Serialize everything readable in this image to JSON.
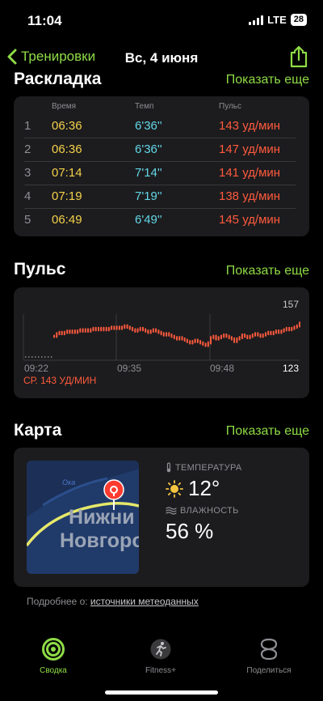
{
  "status": {
    "time": "11:04",
    "network": "LTE",
    "battery": "28"
  },
  "nav": {
    "back_label": "Тренировки",
    "title": "Вс, 4 июня"
  },
  "splits": {
    "title": "Раскладка",
    "show_more": "Показать еще",
    "headers": {
      "time": "Время",
      "pace": "Темп",
      "hr": "Пульс"
    },
    "rows": [
      {
        "n": "1",
        "time": "06:36",
        "pace": "6'36''",
        "hr": "143 уд/мин"
      },
      {
        "n": "2",
        "time": "06:36",
        "pace": "6'36''",
        "hr": "147 уд/мин"
      },
      {
        "n": "3",
        "time": "07:14",
        "pace": "7'14''",
        "hr": "141 уд/мин"
      },
      {
        "n": "4",
        "time": "07:19",
        "pace": "7'19''",
        "hr": "138 уд/мин"
      },
      {
        "n": "5",
        "time": "06:49",
        "pace": "6'49''",
        "hr": "145 уд/мин"
      }
    ]
  },
  "heart_rate": {
    "title": "Пульс",
    "show_more": "Показать еще",
    "max_label": "157",
    "min_label": "123",
    "avg_label": "СР. 143 УД/МИН",
    "time_ticks": [
      "09:22",
      "09:35",
      "09:48"
    ]
  },
  "chart_data": {
    "type": "bar",
    "title": "",
    "ylim": [
      123,
      157
    ],
    "x_ticks": [
      "09:22",
      "09:35",
      "09:48"
    ],
    "color": "#ff5a3d",
    "values": [
      140,
      142,
      143,
      142,
      143,
      144,
      143,
      144,
      143,
      144,
      145,
      144,
      145,
      144,
      145,
      146,
      145,
      146,
      145,
      146,
      145,
      146,
      147,
      146,
      147,
      146,
      147,
      148,
      147,
      146,
      145,
      144,
      145,
      146,
      145,
      144,
      143,
      144,
      145,
      144,
      143,
      142,
      141,
      142,
      141,
      140,
      139,
      138,
      139,
      138,
      137,
      136,
      135,
      136,
      137,
      136,
      135,
      134,
      133,
      135,
      139,
      140,
      138,
      139,
      140,
      141,
      140,
      139,
      138,
      136,
      138,
      139,
      141,
      140,
      139,
      140,
      141,
      142,
      141,
      140,
      141,
      142,
      143,
      142,
      143,
      144,
      143,
      144,
      145,
      146,
      145,
      146,
      147,
      148,
      150
    ]
  },
  "map": {
    "title": "Карта",
    "show_more": "Показать еще",
    "city_line1": "Нижни",
    "city_line2": "Новгоро",
    "river": "Ока",
    "temperature_label": "ТЕМПЕРАТУРА",
    "temperature": "12°",
    "humidity_label": "ВЛАЖНОСТЬ",
    "humidity": "56 %",
    "footnote_prefix": "Подробнее о:",
    "footnote_link": "источники метеоданных"
  },
  "tabs": [
    {
      "label": "Сводка",
      "color": "#8edb46"
    },
    {
      "label": "Fitness+",
      "color": "#8e8e93"
    },
    {
      "label": "Поделиться",
      "color": "#8e8e93"
    }
  ]
}
